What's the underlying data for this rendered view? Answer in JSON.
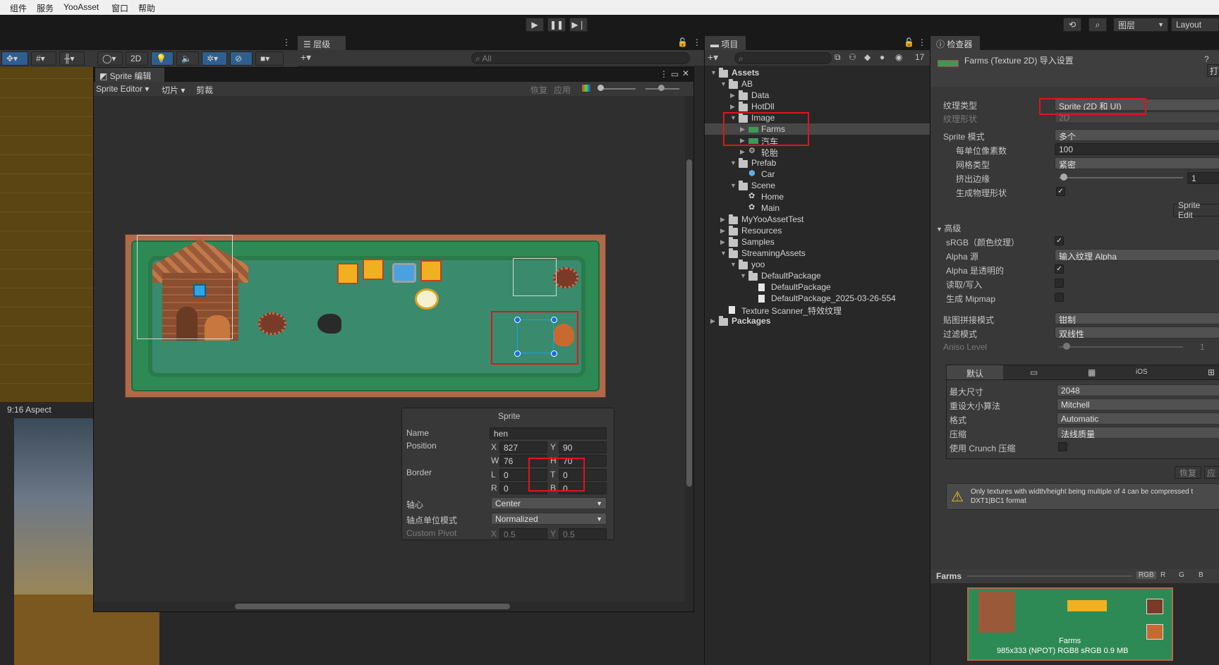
{
  "menu": [
    "组件",
    "服务",
    "YooAsset",
    "窗口",
    "帮助"
  ],
  "toolbar": {
    "play_icon": "play-icon",
    "pause_icon": "pause-icon",
    "step_icon": "step-icon",
    "layers_label": "图层",
    "layout_label": "Layout"
  },
  "scene": {
    "btn_2d": "2D",
    "aspect_label": "9:16 Aspect"
  },
  "hierarchy": {
    "tab": "层级",
    "search_placeholder": "All"
  },
  "sprite_editor": {
    "title": "Sprite 编辑器",
    "menu_editor": "Sprite Editor",
    "menu_slice": "切片",
    "menu_trim": "剪裁",
    "revert": "恢复",
    "apply": "应用",
    "box_title": "Sprite",
    "name_label": "Name",
    "name_value": "hen",
    "position_label": "Position",
    "x_label": "X",
    "x_value": "827",
    "y_label": "Y",
    "y_value": "90",
    "w_label": "W",
    "w_value": "76",
    "h_label": "H",
    "h_value": "70",
    "border_label": "Border",
    "l_label": "L",
    "l_value": "0",
    "t_label": "T",
    "t_value": "0",
    "r_label": "R",
    "r_value": "0",
    "b_label": "B",
    "b_value": "0",
    "pivot_label": "轴心",
    "pivot_value": "Center",
    "pivot_unit_label": "轴点单位模式",
    "pivot_unit_value": "Normalized",
    "custom_pivot_label": "Custom Pivot",
    "cp_x": "0.5",
    "cp_y": "0.5"
  },
  "project": {
    "tab": "项目",
    "hidden_count": "17",
    "tree": [
      {
        "label": "Assets",
        "depth": 0,
        "bold": true,
        "expanded": true,
        "icon": "folder"
      },
      {
        "label": "AB",
        "depth": 1,
        "expanded": true,
        "icon": "folder"
      },
      {
        "label": "Data",
        "depth": 2,
        "expanded": false,
        "icon": "folder"
      },
      {
        "label": "HotDll",
        "depth": 2,
        "expanded": false,
        "icon": "folder"
      },
      {
        "label": "Image",
        "depth": 2,
        "expanded": true,
        "icon": "folder"
      },
      {
        "label": "Farms",
        "depth": 3,
        "expanded": false,
        "icon": "texture",
        "selected": true
      },
      {
        "label": "汽车",
        "depth": 3,
        "expanded": false,
        "icon": "texture"
      },
      {
        "label": "轮胎",
        "depth": 3,
        "expanded": false,
        "icon": "gear"
      },
      {
        "label": "Prefab",
        "depth": 2,
        "expanded": true,
        "icon": "folder"
      },
      {
        "label": "Car",
        "depth": 3,
        "icon": "prefab"
      },
      {
        "label": "Scene",
        "depth": 2,
        "expanded": true,
        "icon": "folder"
      },
      {
        "label": "Home",
        "depth": 3,
        "icon": "scene"
      },
      {
        "label": "Main",
        "depth": 3,
        "icon": "scene"
      },
      {
        "label": "MyYooAssetTest",
        "depth": 1,
        "expanded": false,
        "icon": "folder"
      },
      {
        "label": "Resources",
        "depth": 1,
        "expanded": false,
        "icon": "folder"
      },
      {
        "label": "Samples",
        "depth": 1,
        "expanded": false,
        "icon": "folder"
      },
      {
        "label": "StreamingAssets",
        "depth": 1,
        "expanded": true,
        "icon": "folder"
      },
      {
        "label": "yoo",
        "depth": 2,
        "expanded": true,
        "icon": "folder"
      },
      {
        "label": "DefaultPackage",
        "depth": 3,
        "expanded": true,
        "icon": "folder"
      },
      {
        "label": "DefaultPackage",
        "depth": 4,
        "icon": "file"
      },
      {
        "label": "DefaultPackage_2025-03-26-554",
        "depth": 4,
        "icon": "file"
      },
      {
        "label": "Texture Scanner_特效纹理",
        "depth": 1,
        "icon": "file"
      },
      {
        "label": "Packages",
        "depth": 0,
        "bold": true,
        "expanded": false,
        "icon": "folder"
      }
    ]
  },
  "inspector": {
    "tab": "检查器",
    "title": "Farms (Texture 2D) 导入设置",
    "open_btn": "打",
    "texture_type_label": "纹理类型",
    "texture_type_value": "Sprite (2D 和 UI)",
    "texture_shape_label": "纹理形状",
    "texture_shape_value": "2D",
    "sprite_mode_label": "Sprite 模式",
    "sprite_mode_value": "多个",
    "ppu_label": "每单位像素数",
    "ppu_value": "100",
    "mesh_type_label": "网格类型",
    "mesh_type_value": "紧密",
    "extrude_label": "挤出边缘",
    "extrude_value": "1",
    "gen_physics_label": "生成物理形状",
    "sprite_edit_btn": "Sprite Edit",
    "advanced_label": "高级",
    "srgb_label": "sRGB（颜色纹理）",
    "alpha_source_label": "Alpha 源",
    "alpha_source_value": "输入纹理 Alpha",
    "alpha_transparency_label": "Alpha 是透明的",
    "read_write_label": "读取/写入",
    "mipmap_label": "生成 Mipmap",
    "wrap_label": "贴图拼接模式",
    "wrap_value": "钳制",
    "filter_label": "过滤模式",
    "filter_value": "双线性",
    "aniso_label": "Aniso Level",
    "aniso_value": "1",
    "platform_default": "默认",
    "platform_ios": "iOS",
    "max_size_label": "最大尺寸",
    "max_size_value": "2048",
    "resize_label": "重设大小算法",
    "resize_value": "Mitchell",
    "format_label": "格式",
    "format_value": "Automatic",
    "compression_label": "压缩",
    "compression_value": "法线质量",
    "crunch_label": "使用 Crunch 压缩",
    "revert_btn": "恢复",
    "apply_btn": "应",
    "warning_line1": "Only textures with width/height being multiple of 4 can be compressed t",
    "warning_line2": "DXT1|BC1 format",
    "preview_title": "Farms",
    "channel_rgb": "RGB",
    "channel_r": "R",
    "channel_g": "G",
    "channel_b": "B",
    "preview_name": "Farms",
    "preview_info": "985x333 (NPOT)  RGB8 sRGB   0.9 MB"
  }
}
